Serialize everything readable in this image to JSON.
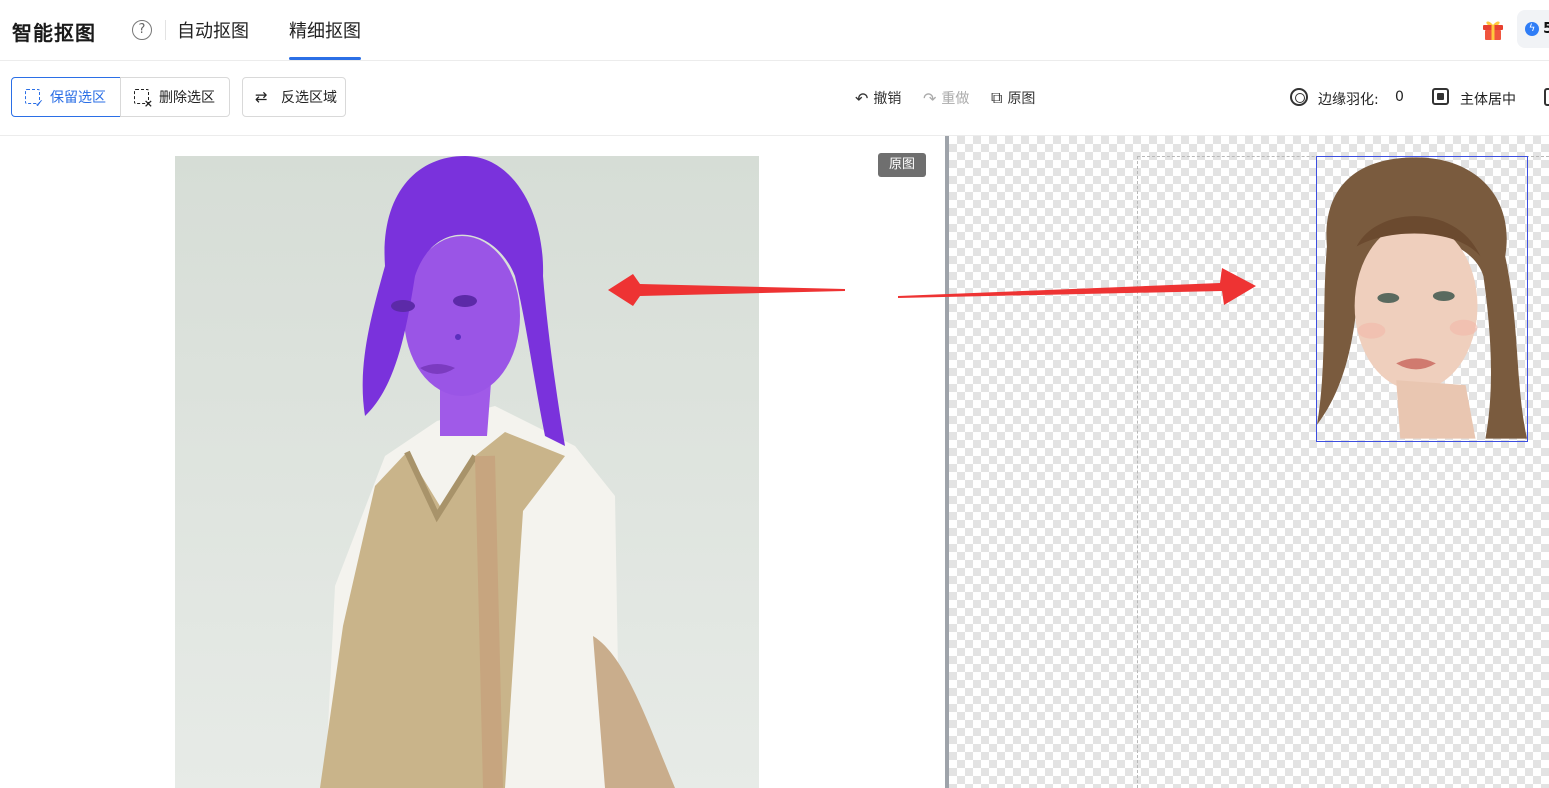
{
  "header": {
    "app_title": "智能抠图",
    "tabs": [
      {
        "label": "自动抠图"
      },
      {
        "label": "精细抠图",
        "active": true
      }
    ],
    "credits": "5"
  },
  "toolbar": {
    "keep_selection": "保留选区",
    "delete_selection": "删除选区",
    "invert_selection": "反选区域",
    "undo": "撤销",
    "redo": "重做",
    "original": "原图",
    "feather_label": "边缘羽化:",
    "feather_value": "0",
    "center_subject": "主体居中"
  },
  "canvas": {
    "original_badge": "原图"
  },
  "colors": {
    "accent": "#2b6fe6",
    "selection_mask": "#8a3cf0",
    "arrow": "#ee3333",
    "cutout_border": "#3d4fe0"
  },
  "icons": [
    "help-icon",
    "gift-icon",
    "bolt-icon",
    "keep-selection-icon",
    "delete-selection-icon",
    "swap-icon",
    "undo-icon",
    "redo-icon",
    "original-image-icon",
    "feather-icon",
    "center-subject-icon"
  ]
}
